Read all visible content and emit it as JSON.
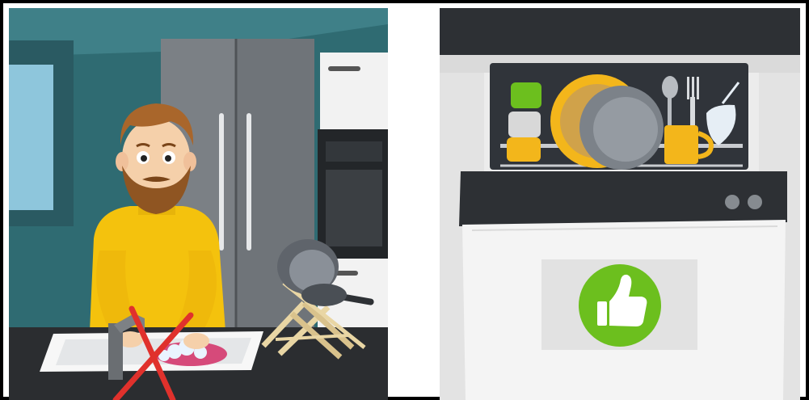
{
  "scene": {
    "left_panel": {
      "subject": "man-washing-dishes-by-hand",
      "marker": "red-x-mark",
      "colors": {
        "wall": "#2f6b72",
        "fridge": "#6f7479",
        "sweater": "#f4c20d",
        "counter": "#2b2d30",
        "x_mark": "#e0312c",
        "drying_rack": "#e9d6a4"
      }
    },
    "right_panel": {
      "subject": "dishwasher-open-with-dishes",
      "marker": "thumbs-up-badge",
      "colors": {
        "badge_bg": "#e2e2e2",
        "badge_green": "#6cbf1e",
        "control_panel": "#2d3034",
        "door": "#f4f4f4",
        "mug": "#f3b61b",
        "cup_green": "#6cbf1e"
      }
    }
  }
}
